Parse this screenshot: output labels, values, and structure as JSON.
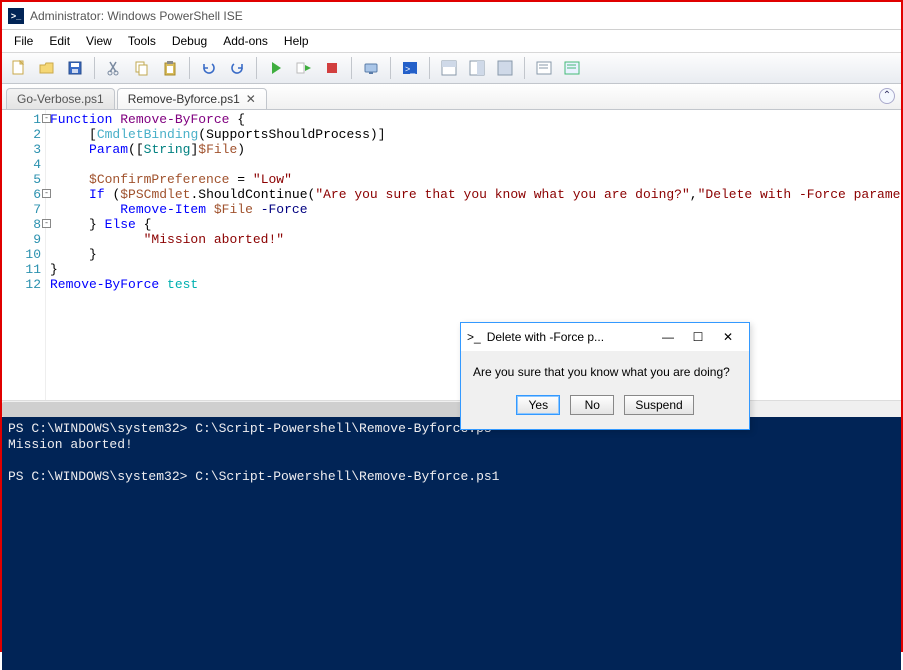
{
  "window": {
    "title": "Administrator: Windows PowerShell ISE"
  },
  "menu": {
    "items": [
      "File",
      "Edit",
      "View",
      "Tools",
      "Debug",
      "Add-ons",
      "Help"
    ]
  },
  "tabs": {
    "inactive": "Go-Verbose.ps1",
    "active": "Remove-Byforce.ps1"
  },
  "code": {
    "lines": [
      {
        "n": 1,
        "fold": "-",
        "html": "<span class='k-blue'>Function</span> <span class='k-ident'>Remove-ByForce</span> <span class='k-black'>{</span>"
      },
      {
        "n": 2,
        "html": "     <span class='k-black'>[</span><span class='k-attr'>CmdletBinding</span><span class='k-black'>(</span><span class='k-black'>SupportsShouldProcess</span><span class='k-black'>)]</span>"
      },
      {
        "n": 3,
        "html": "     <span class='k-blue'>Param</span><span class='k-black'>(</span><span class='k-black'>[</span><span class='k-teal'>String</span><span class='k-black'>]</span><span class='k-var'>$File</span><span class='k-black'>)</span>"
      },
      {
        "n": 4,
        "html": ""
      },
      {
        "n": 5,
        "html": "     <span class='k-var'>$ConfirmPreference</span> <span class='k-black'>=</span> <span class='k-str'>\"Low\"</span>"
      },
      {
        "n": 6,
        "fold": "-",
        "html": "     <span class='k-blue'>If</span> <span class='k-black'>(</span><span class='k-var'>$PSCmdlet</span><span class='k-black'>.</span><span class='k-black'>ShouldContinue</span><span class='k-black'>(</span><span class='k-str'>\"Are you sure that you know what you are doing?\"</span><span class='k-black'>,</span><span class='k-str'>\"Delete with -Force parameter!\"</span><span class='k-black'>))</span>"
      },
      {
        "n": 7,
        "html": "         <span class='k-blue'>Remove-Item</span> <span class='k-var'>$File</span> <span class='k-param'>-Force</span>"
      },
      {
        "n": 8,
        "fold": "-",
        "html": "     <span class='k-black'>}</span> <span class='k-blue'>Else</span> <span class='k-black'>{</span>"
      },
      {
        "n": 9,
        "html": "            <span class='k-str'>\"Mission aborted!\"</span>"
      },
      {
        "n": 10,
        "html": "     <span class='k-black'>}</span>"
      },
      {
        "n": 11,
        "html": "<span class='k-black'>}</span>"
      },
      {
        "n": 12,
        "html": "<span class='k-blue'>Remove-ByForce</span> <span class='k-cyan'>test</span>"
      }
    ]
  },
  "console": {
    "lines": [
      "PS C:\\WINDOWS\\system32> C:\\Script-Powershell\\Remove-Byforce.ps",
      "Mission aborted!",
      "",
      "PS C:\\WINDOWS\\system32> C:\\Script-Powershell\\Remove-Byforce.ps1"
    ]
  },
  "dialog": {
    "title": "Delete with -Force p...",
    "message": "Are you sure that you know what you are doing?",
    "buttons": {
      "yes": "Yes",
      "no": "No",
      "suspend": "Suspend"
    }
  }
}
